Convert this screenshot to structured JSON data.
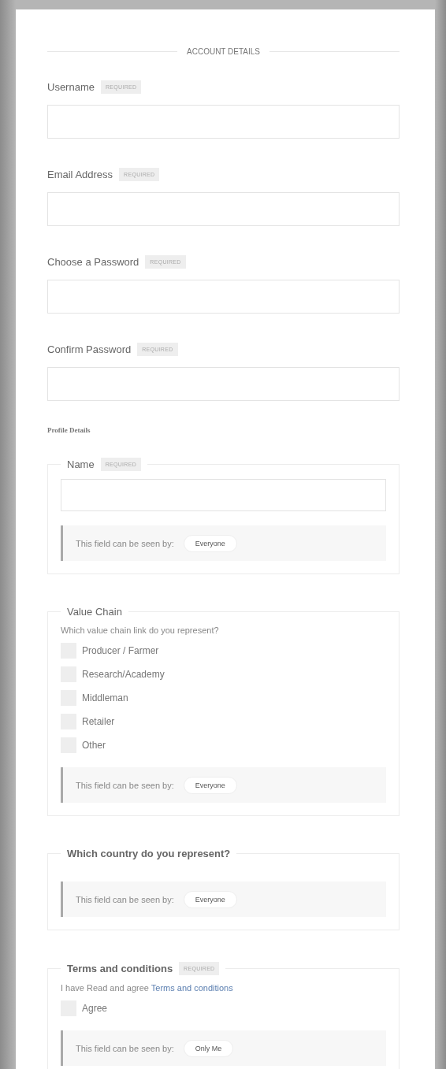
{
  "account_heading": "ACCOUNT DETAILS",
  "account_fields": [
    {
      "label": "Username",
      "badge": "REQUIRED"
    },
    {
      "label": "Email Address",
      "badge": "REQUIRED"
    },
    {
      "label": "Choose a Password",
      "badge": "REQUIRED"
    },
    {
      "label": "Confirm Password",
      "badge": "REQUIRED"
    }
  ],
  "profile_heading": "Profile Details",
  "groups": [
    {
      "kind": "text-input",
      "legend": "Name",
      "badge": "REQUIRED",
      "visibility": {
        "label": "This field can be seen by:",
        "value": "Everyone"
      }
    },
    {
      "kind": "checkboxes",
      "legend": "Value Chain",
      "question": "Which value chain link do you represent?",
      "options": [
        {
          "label": "Producer / Farmer",
          "checked": false
        },
        {
          "label": "Research/Academy",
          "checked": false
        },
        {
          "label": "Middleman",
          "checked": false
        },
        {
          "label": "Retailer",
          "checked": false
        },
        {
          "label": "Other",
          "checked": false
        }
      ],
      "visibility": {
        "label": "This field can be seen by:",
        "value": "Everyone"
      }
    },
    {
      "kind": "empty",
      "legend": "Which country do you represent?",
      "visibility": {
        "label": "This field can be seen by:",
        "value": "Everyone"
      }
    },
    {
      "kind": "checkboxes",
      "legend": "Terms and conditions",
      "badge": "REQUIRED",
      "statement": {
        "text": "I have Read and agree",
        "link": "Terms and conditions"
      },
      "options": [
        {
          "label": "Agree",
          "checked": false
        }
      ],
      "visibility": {
        "label": "This field can be seen by:",
        "value": "Only Me"
      }
    }
  ]
}
